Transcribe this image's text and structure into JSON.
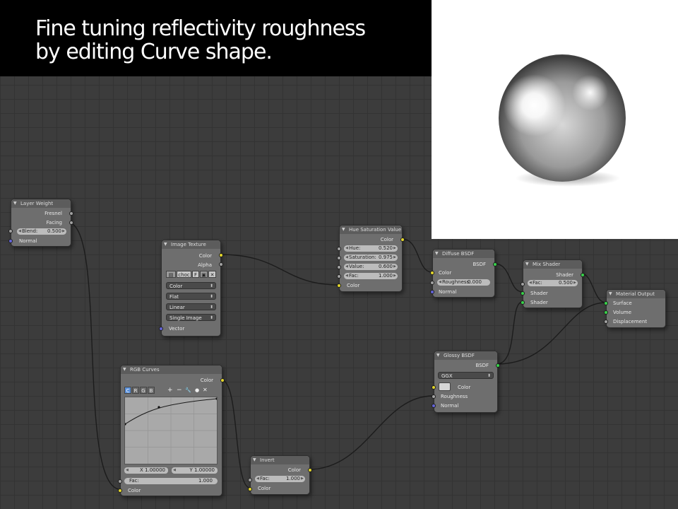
{
  "slide": {
    "title_text": "Fine tuning reflectivity roughness\nby editing Curve shape."
  },
  "nodes": {
    "layer_weight": {
      "title": "Layer Weight",
      "outputs": [
        "Fresnel",
        "Facing"
      ],
      "blend_label": "Blend:",
      "blend_value": "0.500",
      "normal_label": "Normal"
    },
    "image_texture": {
      "title": "Image Texture",
      "outputs": [
        "Color",
        "Alpha"
      ],
      "image_name": "choc",
      "fake_user": "F",
      "color_mode": "Color",
      "projection": "Flat",
      "interpolation": "Linear",
      "source": "Single Image",
      "vector_label": "Vector"
    },
    "hue_sat": {
      "title": "Hue Saturation Value",
      "output": "Color",
      "hue_label": "Hue:",
      "hue_value": "0.520",
      "sat_label": "Saturation:",
      "sat_value": "0.975",
      "val_label": "Value:",
      "val_value": "0.600",
      "fac_label": "Fac:",
      "fac_value": "1.000",
      "color_label": "Color"
    },
    "diffuse": {
      "title": "Diffuse BSDF",
      "output": "BSDF",
      "color_label": "Color",
      "roughness_label": "Roughness:",
      "roughness_value": "0.000",
      "normal_label": "Normal"
    },
    "mix_shader": {
      "title": "Mix Shader",
      "output": "Shader",
      "fac_label": "Fac:",
      "fac_value": "0.500",
      "shader1": "Shader",
      "shader2": "Shader"
    },
    "material_output": {
      "title": "Material Output",
      "inputs": [
        "Surface",
        "Volume",
        "Displacement"
      ]
    },
    "rgb_curves": {
      "title": "RGB Curves",
      "output": "Color",
      "channels": [
        "C",
        "R",
        "G",
        "B"
      ],
      "tools": [
        "+",
        "−",
        "🔧",
        "●",
        "✕"
      ],
      "x_label": "X 1.00000",
      "y_label": "Y 1.00000",
      "fac_label": "Fac:",
      "fac_value": "1.000",
      "color_label": "Color"
    },
    "invert": {
      "title": "Invert",
      "output": "Color",
      "fac_label": "Fac:",
      "fac_value": "1.000",
      "color_label": "Color"
    },
    "glossy": {
      "title": "Glossy BSDF",
      "output": "BSDF",
      "distribution": "GGX",
      "color_label": "Color",
      "roughness_label": "Roughness",
      "normal_label": "Normal"
    }
  },
  "colors": {
    "socket_shader": "#37d24a",
    "socket_color": "#e3d62b",
    "socket_float": "#a2a2a2",
    "socket_vector": "#6464d8",
    "grid_background": "#3c3c3c"
  }
}
